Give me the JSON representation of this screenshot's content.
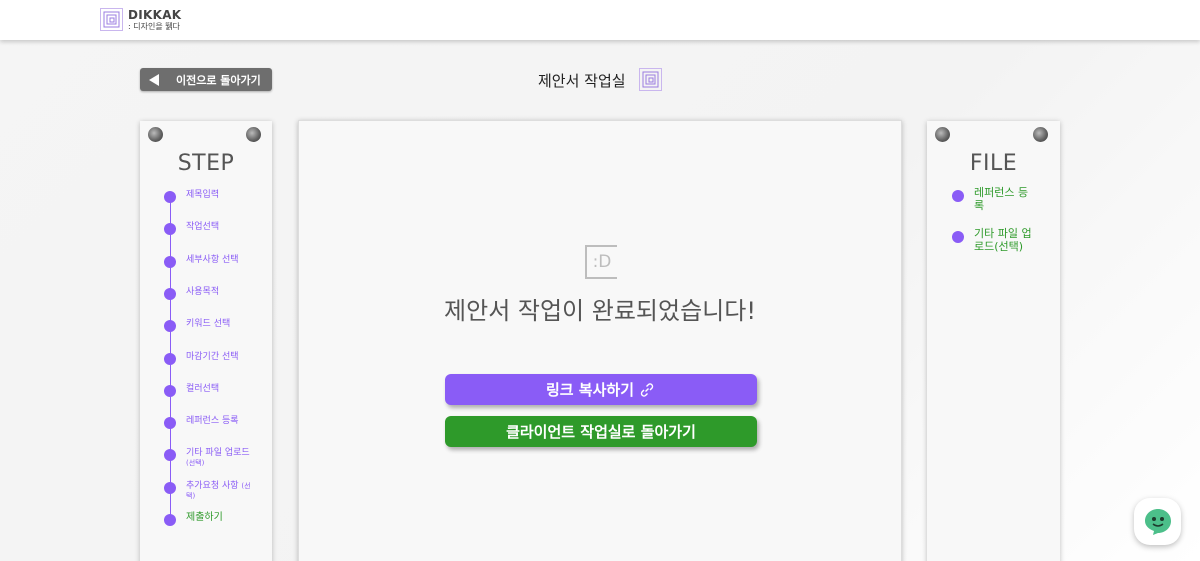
{
  "header": {
    "brand": "DIKKAK",
    "tagline": ": 디자인을 뛝다"
  },
  "nav": {
    "back_label": "이전으로 돌아가기",
    "page_title": "제안서 작업실"
  },
  "steps": {
    "heading": "STEP",
    "items": [
      {
        "label": "제목입력"
      },
      {
        "label": "작업선택"
      },
      {
        "label": "세부사항 선택"
      },
      {
        "label": "사용목적"
      },
      {
        "label": "키워드 선택"
      },
      {
        "label": "마감기간 선택"
      },
      {
        "label": "컬러선택"
      },
      {
        "label": "레퍼런스 등록"
      },
      {
        "label": "기타 파일 업로드",
        "note": "(선택)"
      },
      {
        "label": "추가요청 사항",
        "note": "(선택)"
      },
      {
        "label": "제출하기"
      }
    ]
  },
  "main": {
    "logo_text": ":D",
    "message": "제안서 작업이 완료되었습니다!",
    "copy_link_label": "링크 복사하기",
    "return_label": "클라이언트 작업실로 돌아가기"
  },
  "files": {
    "heading": "FILE",
    "items": [
      {
        "label": "레퍼런스 등록"
      },
      {
        "label": "기타 파일 업로드(선택)"
      }
    ]
  },
  "colors": {
    "accent": "#8a5cf6",
    "success": "#2e9a2a",
    "back_button": "#6e6e6e",
    "chat": "#4cbf8a"
  },
  "icons": {
    "logo": "dikkak-logo-icon",
    "back": "triangle-left-icon",
    "link": "link-icon",
    "chat": "chat-bot-icon",
    "pin": "pushpin-icon"
  }
}
